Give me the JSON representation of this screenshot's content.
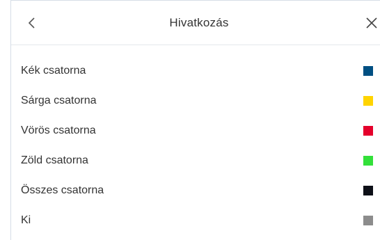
{
  "header": {
    "title": "Hivatkozás"
  },
  "channels": [
    {
      "label": "Kék csatorna",
      "color": "#004f82"
    },
    {
      "label": "Sárga csatorna",
      "color": "#ffd400"
    },
    {
      "label": "Vörös csatorna",
      "color": "#e4002b"
    },
    {
      "label": "Zöld csatorna",
      "color": "#33e03a"
    },
    {
      "label": "Összes csatorna",
      "color": "#0d0f17"
    },
    {
      "label": "Ki",
      "color": "#8c8c8c"
    }
  ],
  "icons": {
    "back": "chevron-left-icon",
    "close": "close-icon"
  }
}
